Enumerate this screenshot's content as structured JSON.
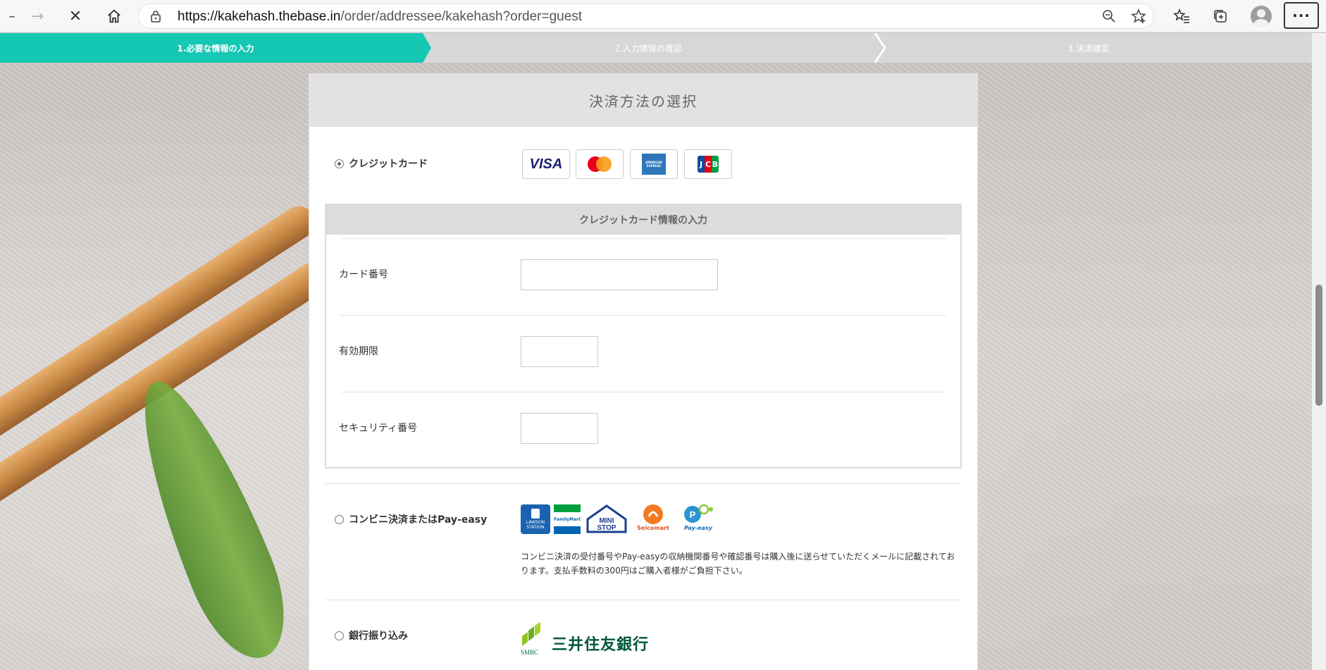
{
  "browser": {
    "url_host": "https://kakehash.thebase.in",
    "url_path": "/order/addressee/kakehash?order=guest"
  },
  "steps": [
    {
      "label": "1.必要な情報の入力",
      "active": true
    },
    {
      "label": "2.入力情報の確認",
      "active": false
    },
    {
      "label": "3.決済確定",
      "active": false
    }
  ],
  "payment": {
    "title": "決済方法の選択",
    "credit": {
      "label": "クレジットカード",
      "selected": true,
      "brands": [
        "VISA",
        "Mastercard",
        "AMERICAN EXPRESS",
        "JCB"
      ],
      "form_title": "クレジットカード情報の入力",
      "card_number_label": "カード番号",
      "expiry_label": "有効期限",
      "security_label": "セキュリティ番号"
    },
    "conbini": {
      "label": "コンビニ決済またはPay-easy",
      "selected": false,
      "stores": [
        "LAWSON STATION",
        "FamilyMart",
        "MINI STOP",
        "Seicomart",
        "Pay-easy"
      ],
      "note": "コンビニ決済の受付番号やPay-easyの収納機関番号や確認番号は購入後に送らせていただくメールに記載されております。支払手数料の300円はご購入者様がご負担下さい。"
    },
    "bank": {
      "label": "銀行振り込み",
      "selected": false,
      "bank_logo_text": "SMBC",
      "bank_name": "三井住友銀行"
    }
  },
  "colors": {
    "accent": "#14c8b4",
    "step_inactive": "#d7d7d7",
    "header_gray": "#e2e2e2"
  }
}
